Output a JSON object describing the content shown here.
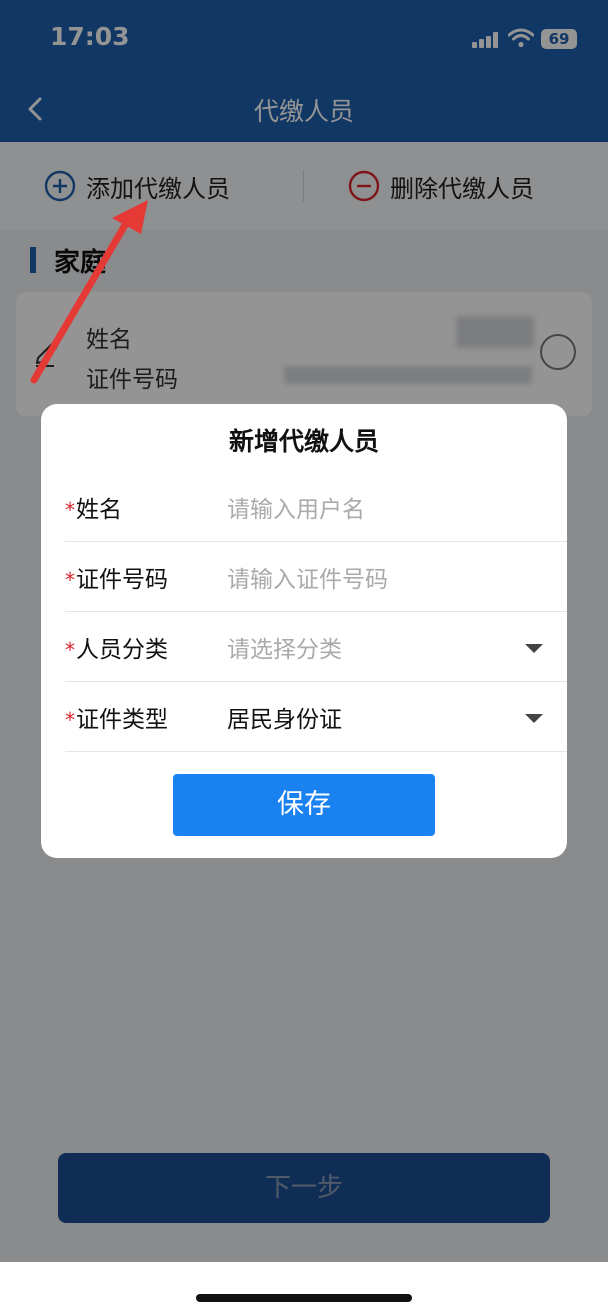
{
  "status_bar": {
    "time": "17:03",
    "battery": "69"
  },
  "nav": {
    "title": "代缴人员"
  },
  "actions": {
    "add_label": "添加代缴人员",
    "delete_label": "删除代缴人员"
  },
  "section": {
    "title": "家庭"
  },
  "member_card": {
    "name_label": "姓名",
    "id_label": "证件号码"
  },
  "modal": {
    "title": "新增代缴人员",
    "required_mark": "*",
    "fields": [
      {
        "label": "姓名",
        "placeholder": "请输入用户名",
        "value": ""
      },
      {
        "label": "证件号码",
        "placeholder": "请输入证件号码",
        "value": ""
      },
      {
        "label": "人员分类",
        "placeholder": "请选择分类",
        "value": ""
      },
      {
        "label": "证件类型",
        "placeholder": "",
        "value": "居民身份证"
      }
    ],
    "save_label": "保存"
  },
  "footer": {
    "next_label": "下一步"
  },
  "colors": {
    "primary": "#1e5fae",
    "save": "#1a82f0",
    "required": "#d8252b",
    "annotation_arrow": "#e53935"
  }
}
